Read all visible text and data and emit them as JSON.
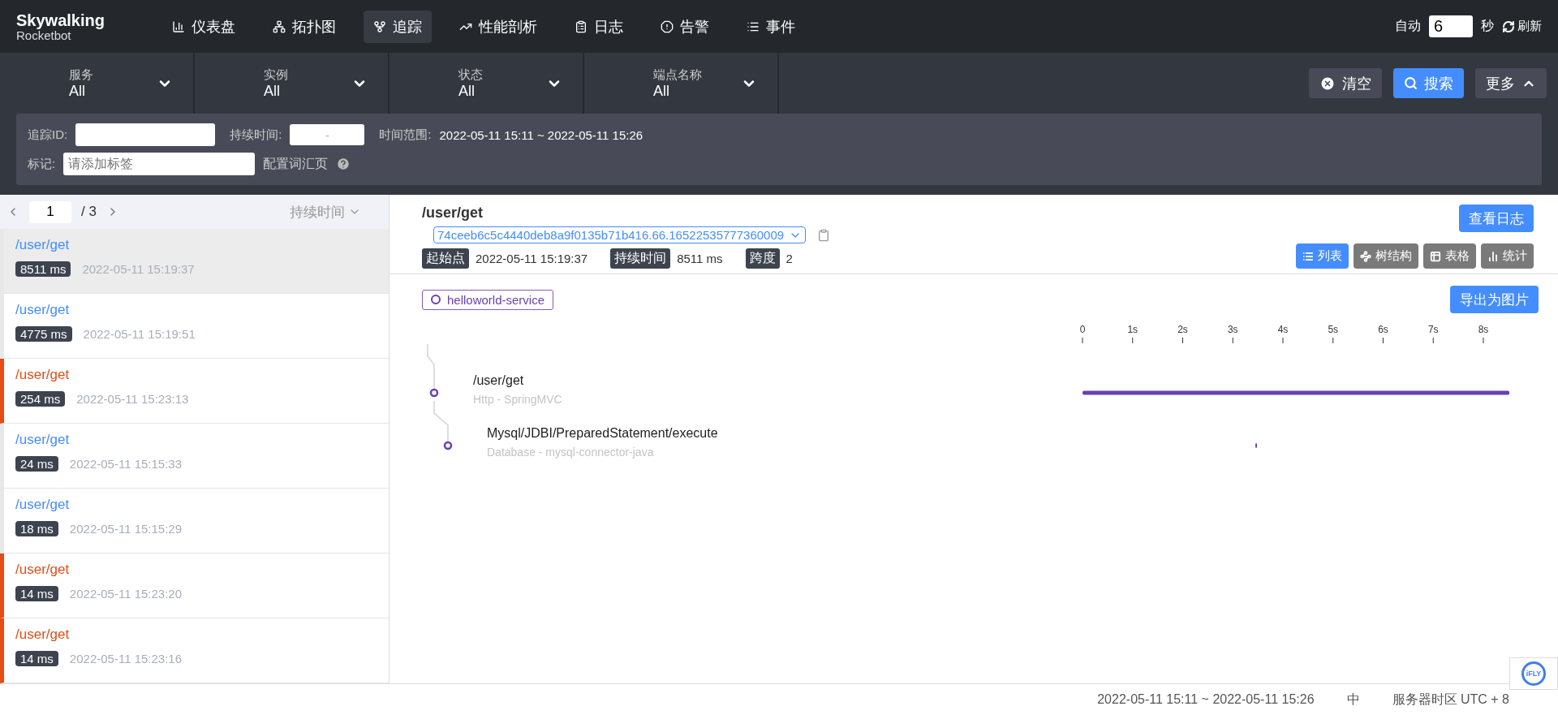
{
  "logo": {
    "title": "Skywalking",
    "subtitle": "Rocketbot"
  },
  "nav": [
    {
      "label": "仪表盘",
      "selected": false
    },
    {
      "label": "拓扑图",
      "selected": false
    },
    {
      "label": "追踪",
      "selected": true
    },
    {
      "label": "性能剖析",
      "selected": false
    },
    {
      "label": "日志",
      "selected": false
    },
    {
      "label": "告警",
      "selected": false
    },
    {
      "label": "事件",
      "selected": false
    }
  ],
  "auto_refresh": {
    "label": "自动",
    "value": "6",
    "unit": "秒",
    "refresh": "刷新"
  },
  "filters": [
    {
      "label": "服务",
      "value": "All"
    },
    {
      "label": "实例",
      "value": "All"
    },
    {
      "label": "状态",
      "value": "All"
    },
    {
      "label": "端点名称",
      "value": "All"
    }
  ],
  "actions": {
    "clear": "清空",
    "search": "搜索",
    "more": "更多",
    "more_expanded": true
  },
  "advanced": {
    "trace_id_label": "追踪ID:",
    "duration_label": "持续时间:",
    "duration_separator": "-",
    "time_range_label": "时间范围:",
    "time_range": "2022-05-11 15:11 ~ 2022-05-11 15:26",
    "tag_label": "标记:",
    "tag_placeholder": "请添加标签",
    "vocab_link": "配置词汇页"
  },
  "pager": {
    "current": "1",
    "total": "/ 3",
    "sort": "持续时间"
  },
  "traces": [
    {
      "endpoint": "/user/get",
      "duration": "8511 ms",
      "time": "2022-05-11 15:19:37",
      "selected": true,
      "error": false
    },
    {
      "endpoint": "/user/get",
      "duration": "4775 ms",
      "time": "2022-05-11 15:19:51",
      "selected": false,
      "error": false
    },
    {
      "endpoint": "/user/get",
      "duration": "254 ms",
      "time": "2022-05-11 15:23:13",
      "selected": false,
      "error": true
    },
    {
      "endpoint": "/user/get",
      "duration": "24 ms",
      "time": "2022-05-11 15:15:33",
      "selected": false,
      "error": false
    },
    {
      "endpoint": "/user/get",
      "duration": "18 ms",
      "time": "2022-05-11 15:15:29",
      "selected": false,
      "error": false
    },
    {
      "endpoint": "/user/get",
      "duration": "14 ms",
      "time": "2022-05-11 15:23:20",
      "selected": false,
      "error": true
    },
    {
      "endpoint": "/user/get",
      "duration": "14 ms",
      "time": "2022-05-11 15:23:16",
      "selected": false,
      "error": true
    }
  ],
  "detail": {
    "title": "/user/get",
    "trace_id": "74ceeb6c5c4440deb8a9f0135b71b416.66.16522535777360009",
    "view_logs": "查看日志",
    "meta": [
      {
        "label": "起始点",
        "value": "2022-05-11 15:19:37"
      },
      {
        "label": "持续时间",
        "value": "8511 ms"
      },
      {
        "label": "跨度",
        "value": "2"
      }
    ],
    "views": [
      {
        "label": "列表",
        "selected": true
      },
      {
        "label": "树结构",
        "selected": false
      },
      {
        "label": "表格",
        "selected": false
      },
      {
        "label": "统计",
        "selected": false
      }
    ],
    "service": "helloworld-service",
    "export": "导出为图片",
    "spans": [
      {
        "name": "/user/get",
        "component": "Http - SpringMVC",
        "children": [
          {
            "name": "Mysql/JDBI/PreparedStatement/execute",
            "component": "Database - mysql-connector-java"
          }
        ]
      }
    ],
    "timeline_ticks": [
      "0",
      "1s",
      "2s",
      "3s",
      "4s",
      "5s",
      "6s",
      "7s",
      "8s"
    ]
  },
  "status_bar": {
    "time_range": "2022-05-11 15:11 ~ 2022-05-11 15:26",
    "language": "中",
    "timezone": "服务器时区 UTC + 8"
  },
  "ime_widget": {
    "label": "iFLY"
  }
}
